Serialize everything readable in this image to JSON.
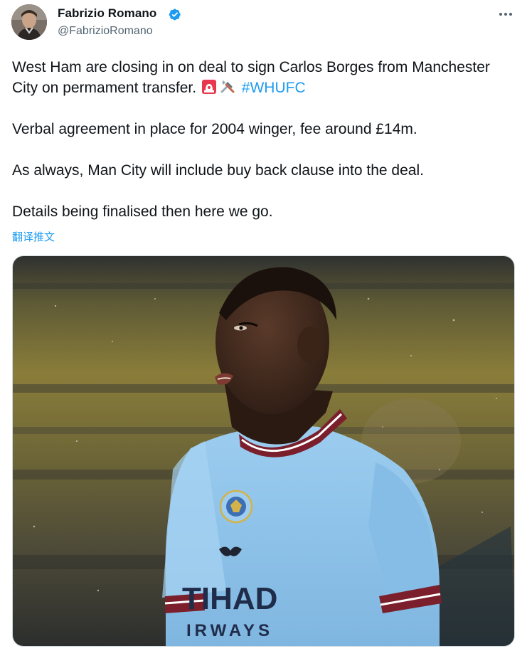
{
  "author": {
    "display_name": "Fabrizio Romano",
    "handle": "@FabrizioRomano",
    "verified": true,
    "avatar_icon": "profile-photo",
    "verified_icon": "verified-badge-icon"
  },
  "actions": {
    "more_icon": "more-horizontal-icon"
  },
  "tweet": {
    "line1": "West Ham are closing in on deal to sign Carlos Borges from Manchester City on permament transfer.",
    "emoji1": "🚨",
    "emoji2": "🛠️",
    "hashtag": "#WHUFC",
    "line2": "Verbal agreement in place for 2004 winger, fee around £14m.",
    "line3": "As always, Man City will include buy back clause into the deal.",
    "line4": "Details being finalised then here we go.",
    "translate_label": "翻译推文"
  },
  "media": {
    "shirt_text_top": "TIHAD",
    "shirt_text_bottom": "IRWAYS",
    "crest_text": "MANCHESTER CITY"
  },
  "colors": {
    "hashtag": "#1d9bf0",
    "verified": "#1d9bf0",
    "secondary_text": "#536471",
    "shirt_blue": "#8ec3ea",
    "shirt_trim": "#7a1f2b"
  }
}
